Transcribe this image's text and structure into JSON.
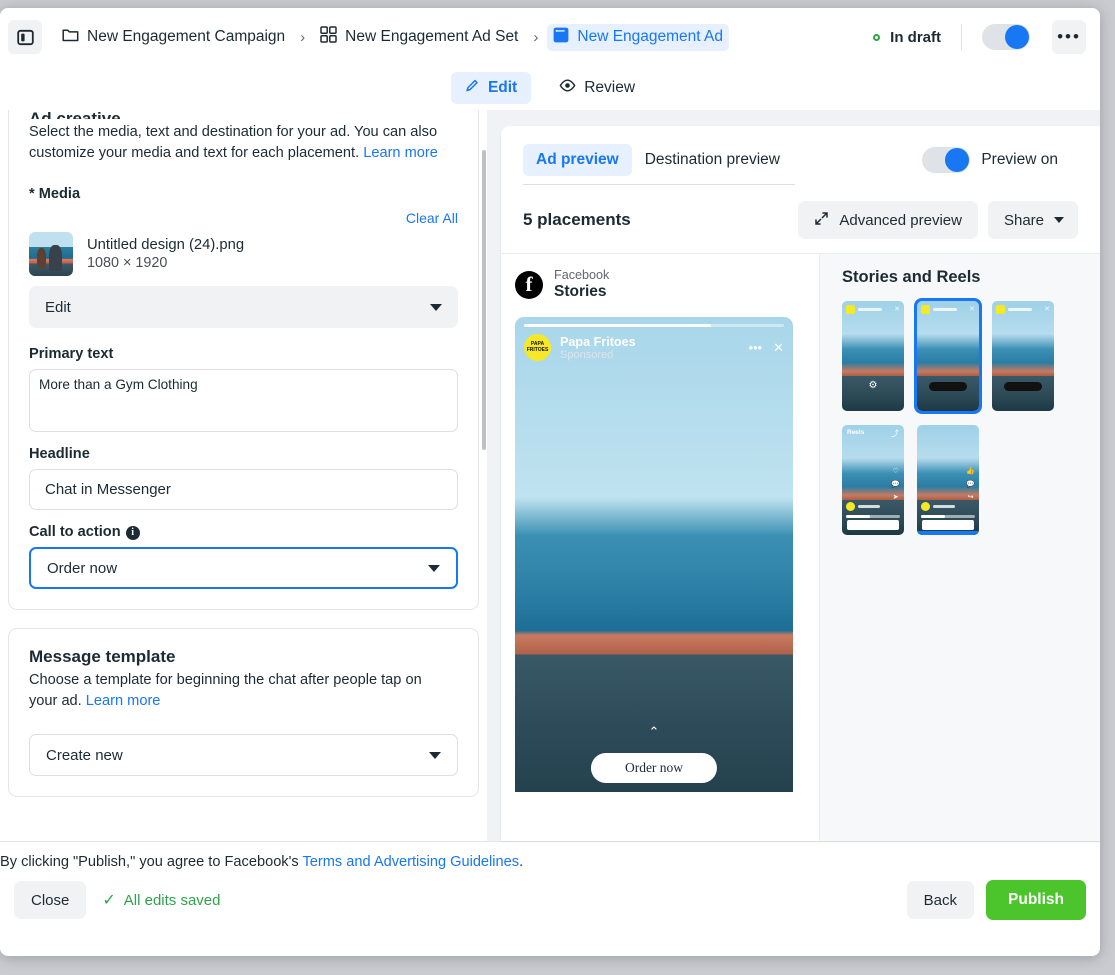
{
  "header": {
    "panel_toggle_icon": "sidebar-panel-icon",
    "breadcrumbs": [
      {
        "label": "New Engagement Campaign",
        "icon": "folder-icon",
        "active": false
      },
      {
        "label": "New Engagement Ad Set",
        "icon": "grid-icon",
        "active": false
      },
      {
        "label": "New Engagement Ad",
        "icon": "ad-square-icon",
        "active": true
      }
    ],
    "separator": "›",
    "status_label": "In draft",
    "status_color": "#31a24c",
    "toggle_on": true,
    "more_icon": "•••"
  },
  "modebar": {
    "edit_label": "Edit",
    "edit_icon": "pencil-icon",
    "review_label": "Review",
    "review_icon": "eye-icon",
    "active": "Edit"
  },
  "left_panel": {
    "ad_creative": {
      "title": "Ad creative",
      "description_1": "Select the media, text and destination for your ad. You can also",
      "description_2": "customize your media and text for each placement.",
      "learn_more": "Learn more"
    },
    "media": {
      "label": "* Media",
      "clear_all": "Clear All",
      "file_name": "Untitled design (24).png",
      "dimensions": "1080 × 1920",
      "edit_select_value": "Edit"
    },
    "primary_text": {
      "label": "Primary text",
      "value": "More than a Gym Clothing"
    },
    "headline": {
      "label": "Headline",
      "value": "Chat in Messenger"
    },
    "call_to_action": {
      "label": "Call to action",
      "info_icon": "info-icon",
      "value": "Order now",
      "focused": true
    },
    "message_template": {
      "title": "Message template",
      "description_1": "Choose a template for beginning the chat after people tap on",
      "description_2": "your ad.",
      "learn_more": "Learn more",
      "select_value": "Create new"
    }
  },
  "preview": {
    "tabs": [
      {
        "label": "Ad preview",
        "active": true
      },
      {
        "label": "Destination preview",
        "active": false
      }
    ],
    "toggle_label": "Preview on",
    "toggle_on": true,
    "placements_count": "5 placements",
    "advanced_preview": "Advanced preview",
    "advanced_icon": "expand-icon",
    "share_label": "Share",
    "platform": {
      "network": "Facebook",
      "surface": "Stories"
    },
    "story": {
      "advertiser": "Papa Fritoes",
      "sponsored": "Sponsored",
      "more_icon": "•••",
      "close_icon": "✕",
      "chevron_up": "⌃",
      "cta_label": "Order now"
    },
    "stories_and_reels": {
      "title": "Stories and Reels",
      "thumbnails": [
        {
          "kind": "story",
          "selected": false,
          "badge": ""
        },
        {
          "kind": "story",
          "selected": true,
          "badge": ""
        },
        {
          "kind": "story",
          "selected": false,
          "badge": ""
        },
        {
          "kind": "reels",
          "selected": false,
          "badge": "Reels"
        },
        {
          "kind": "reels-feed",
          "selected": false,
          "badge": ""
        }
      ]
    }
  },
  "footer": {
    "legal_prefix": "By clicking \"Publish,\" you agree to Facebook's ",
    "legal_link": "Terms and Advertising Guidelines",
    "legal_suffix": ".",
    "close_label": "Close",
    "saved_label": "All edits saved",
    "saved_check": "✓",
    "back_label": "Back",
    "publish_label": "Publish",
    "publish_color": "#4cc42c"
  }
}
